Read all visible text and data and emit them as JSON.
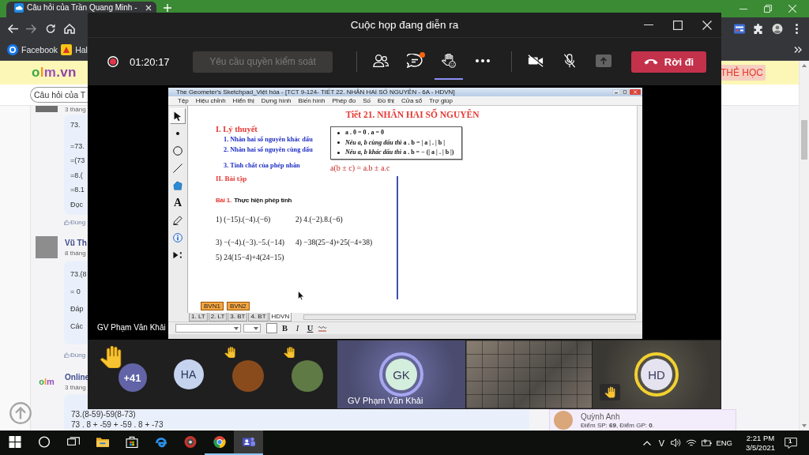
{
  "browser": {
    "tab": {
      "title": "Câu hỏi của Trần Quang Minh -",
      "selected": true
    },
    "bookmarks": [
      {
        "kind": "facebook",
        "label": "Facebook"
      },
      {
        "kind": "site",
        "label": "Hal"
      }
    ]
  },
  "site": {
    "logo": "olm.vn",
    "header_link": "THẺ HỌC",
    "breadcrumb": "Câu hỏi của T",
    "comments": [
      {
        "kind": "photo",
        "time": "3 tháng",
        "lines": [
          "73.",
          "=73.",
          "=(73",
          "=8.(",
          "=8.1",
          "Đọc"
        ],
        "like": "Đúng"
      },
      {
        "kind": "photo",
        "author": "Vũ Th",
        "time": "8 tháng",
        "lines": [
          "73.(8",
          "= 0",
          "Đáp",
          "Các"
        ],
        "like": "Đúng"
      },
      {
        "kind": "logo",
        "logo": "olm",
        "author": "Online",
        "time": "3 tháng",
        "lines": [
          "73.(8-59)-59(8-73)",
          "73 . 8 + -59 + -59 . 8 + -73"
        ]
      }
    ],
    "sidebar_user": {
      "name": "Quỳnh Anh",
      "stats": "Điểm SP: **69**, Điểm GP: **0**."
    }
  },
  "meeting": {
    "title": "Cuộc họp đang diễn ra",
    "recording": true,
    "duration": "01:20:17",
    "request_control": {
      "label": "Yêu cầu quyền kiểm soát",
      "disabled": true
    },
    "controls": [
      {
        "kind": "participants",
        "selected": false,
        "unread": false
      },
      {
        "kind": "chat",
        "selected": false,
        "unread": true
      },
      {
        "kind": "reactions",
        "selected": true,
        "unread": false
      },
      {
        "kind": "more",
        "selected": false,
        "unread": false
      }
    ],
    "media": [
      {
        "kind": "camera",
        "on": false
      },
      {
        "kind": "mic",
        "on": false
      },
      {
        "kind": "share",
        "disabled": true
      }
    ],
    "leave": "Rời đi",
    "presenter": "GV Phạm Văn Khải",
    "shared_screen": {
      "app_title": "The Geometer's Sketchpad_Việt hóa - [TCT 9-124- TIẾT 22. NHÂN HAI SỐ NGUYÊN - 6A - HDVN]",
      "menu": [
        "Tệp",
        "Hiệu chỉnh",
        "Hiển thị",
        "Dựng hình",
        "Biến hình",
        "Phép đo",
        "Số",
        "Đồ thị",
        "Cửa sổ",
        "Trợ giúp"
      ],
      "tools": [
        {
          "kind": "arrow",
          "selected": true
        },
        {
          "kind": "point",
          "selected": false
        },
        {
          "kind": "compass",
          "selected": false
        },
        {
          "kind": "line",
          "selected": false
        },
        {
          "kind": "polygon",
          "selected": false
        },
        {
          "kind": "text",
          "label": "A",
          "selected": false
        },
        {
          "kind": "marker",
          "selected": false
        },
        {
          "kind": "info",
          "selected": false
        },
        {
          "kind": "custom",
          "selected": false
        }
      ],
      "heading": "Tiết 21. NHÂN HAI SỐ NGUYÊN",
      "outline": [
        {
          "kind": "section",
          "text": "I. Lý thuyết"
        },
        {
          "kind": "topic",
          "text": "1. Nhân hai số nguyên khác dấu"
        },
        {
          "kind": "topic",
          "text": "2. Nhân hai số nguyên cùng dấu"
        },
        {
          "kind": "topic",
          "text": "3. Tính chất của phép nhân"
        },
        {
          "kind": "section",
          "text": "II. Bài tập"
        }
      ],
      "rules": [
        "a . 0 = 0 . a = 0",
        "*Nếu a, b cùng dấu thì* a . b = | a | . | b |",
        "*Nếu a, b khác dấu thì* a . b = − (| a | . | b |)"
      ],
      "formula": "a(b ± c) = a.b ± a.c",
      "exercise_label": "Bài 1.",
      "exercise_title": "Thực hiện phép tính",
      "exercises": [
        "1) (−15).(−4).(−6)",
        "2) 4.(−2).8.(−6)",
        "3) −(−4).(−3).−5.(−14)",
        "4) −38(25−4)+25(−4+38)",
        "5) 24(15−4)+4(24−15)"
      ],
      "buttons": [
        "BVN1",
        "BVN2"
      ],
      "pages": [
        {
          "label": "1. LT",
          "selected": false
        },
        {
          "label": "2. LT",
          "selected": false
        },
        {
          "label": "3. BT",
          "selected": false
        },
        {
          "label": "4. BT",
          "selected": false
        },
        {
          "label": "HDVN",
          "selected": true
        }
      ],
      "format_buttons": [
        {
          "kind": "bold",
          "label": "B"
        },
        {
          "kind": "italic",
          "label": "I"
        },
        {
          "kind": "underline",
          "label": "U"
        }
      ]
    },
    "participants": [
      {
        "kind": "overflow",
        "count": "+41",
        "hand_raised": true
      },
      {
        "kind": "initials",
        "initials": "HA",
        "color": "#c5d3ee",
        "hand_raised": false
      },
      {
        "kind": "picture",
        "hand_raised": true
      },
      {
        "kind": "picture",
        "hand_raised": true
      },
      {
        "kind": "tile",
        "initials": "GK",
        "color": "#d3eedd",
        "name": "GV Phạm Văn Khải",
        "speaking": true,
        "hand_raised": false
      },
      {
        "kind": "video"
      },
      {
        "kind": "tile",
        "initials": "HD",
        "color": "#e4e3ef",
        "speaking": false,
        "hand_raised": true
      }
    ]
  },
  "taskbar": {
    "apps": [
      {
        "kind": "explorer",
        "running": false,
        "selected": false
      },
      {
        "kind": "store",
        "running": false,
        "selected": false
      },
      {
        "kind": "edge",
        "running": false,
        "selected": false
      },
      {
        "kind": "recorder",
        "running": false,
        "selected": false
      },
      {
        "kind": "chrome",
        "running": true,
        "selected": false
      },
      {
        "kind": "teams",
        "running": true,
        "selected": true
      }
    ],
    "input_mode": "V",
    "language": "ENG",
    "time": "2:21 PM",
    "date": "3/5/2021",
    "notifications": "1"
  }
}
